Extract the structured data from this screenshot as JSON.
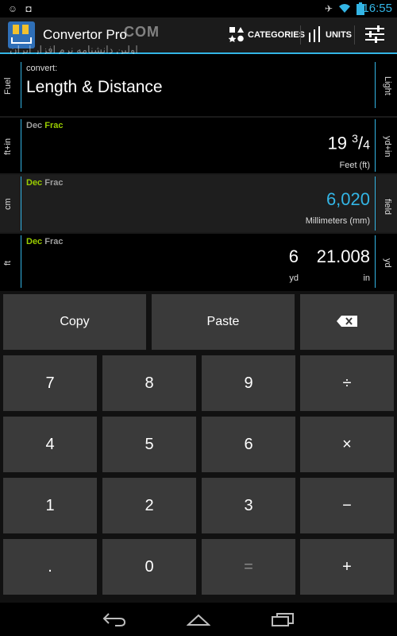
{
  "status_bar": {
    "time": "16:55"
  },
  "action_bar": {
    "title": "Convertor Pro",
    "watermark_text": ".COM",
    "watermark_subtext": "اولین دانشنامه نرم افزار ایران",
    "categories_label": "CATEGORIES",
    "units_label": "UNITS"
  },
  "convert_row": {
    "left_side_label": "Fuel",
    "right_side_label": "Light",
    "caption": "convert:",
    "category": "Length & Distance"
  },
  "row1": {
    "left_side_label": "ft+in",
    "right_side_label": "yd+in",
    "mode_dec": "Dec",
    "mode_frac": "Frac",
    "value_whole": "19",
    "value_num": "3",
    "value_slash": "/",
    "value_den": "4",
    "unit": "Feet (ft)"
  },
  "row2": {
    "left_side_label": "cm",
    "right_side_label": "field",
    "mode_dec": "Dec",
    "mode_frac": "Frac",
    "value": "6,020",
    "unit": "Millimeters (mm)"
  },
  "row3": {
    "left_side_label": "ft",
    "right_side_label": "yd",
    "mode_dec": "Dec",
    "mode_frac": "Frac",
    "value_a": "6",
    "value_b": "21.008",
    "unit_a": "yd",
    "unit_b": "in"
  },
  "keypad": {
    "copy": "Copy",
    "paste": "Paste",
    "k7": "7",
    "k8": "8",
    "k9": "9",
    "divide": "÷",
    "k4": "4",
    "k5": "5",
    "k6": "6",
    "multiply": "×",
    "k1": "1",
    "k2": "2",
    "k3": "3",
    "minus": "−",
    "dot": ".",
    "k0": "0",
    "equals": "=",
    "plus": "+"
  },
  "colors": {
    "accent": "#33b5e5",
    "mode_active": "#99cc00",
    "key_bg": "#3a3a3a"
  }
}
